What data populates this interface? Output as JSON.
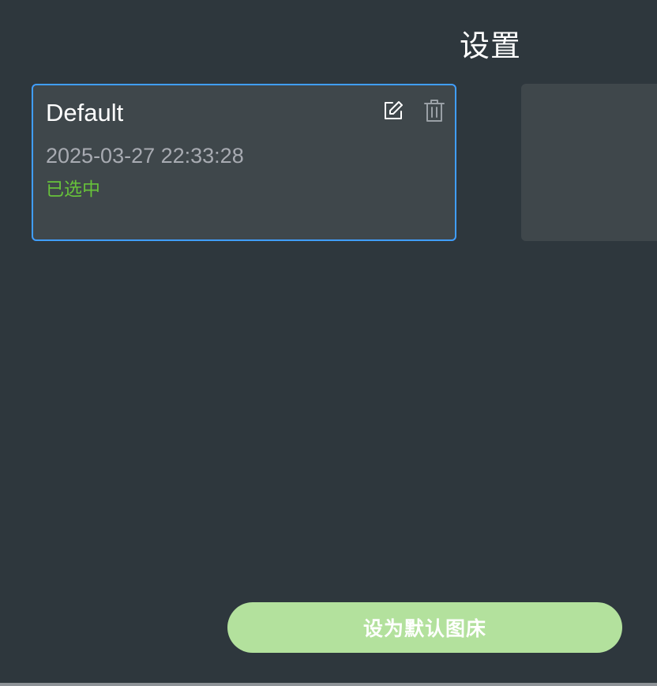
{
  "page": {
    "title": "设置"
  },
  "cards": [
    {
      "name": "Default",
      "date": "2025-03-27 22:33:28",
      "status": "已选中",
      "selected": true
    }
  ],
  "icons": {
    "edit": "edit-icon",
    "delete": "trash-icon"
  },
  "actions": {
    "set_default_label": "设为默认图床"
  },
  "colors": {
    "background": "#2e373d",
    "card": "#3f474b",
    "selected_border": "#409eff",
    "status_selected": "#67c23a",
    "primary_disabled": "#b3e19d"
  }
}
